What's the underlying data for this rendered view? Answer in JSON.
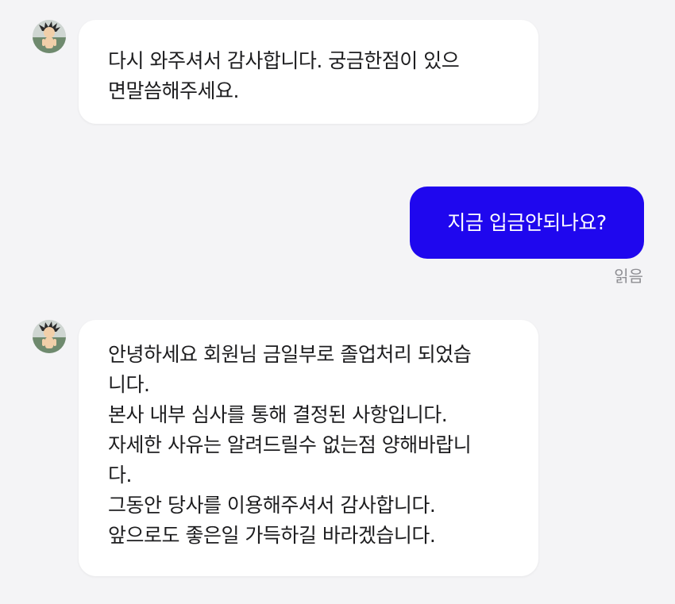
{
  "messages": [
    {
      "sender": "agent",
      "avatar_icon": "character-avatar-icon",
      "lines": [
        "다시 와주셔서 감사합니다. 궁금한점이 있으",
        "면말씀해주세요."
      ]
    },
    {
      "sender": "user",
      "text": "지금 입금안되나요?",
      "status": "읽음"
    },
    {
      "sender": "agent",
      "avatar_icon": "character-avatar-icon",
      "lines": [
        "안녕하세요 회원님 금일부로 졸업처리 되었습",
        "니다.",
        "본사 내부 심사를 통해 결정된 사항입니다.",
        "자세한 사유는 알려드릴수 없는점 양해바랍니",
        "다.",
        "그동안 당사를 이용해주셔서 감사합니다.",
        "앞으로도 좋은일 가득하길 바라겠습니다."
      ]
    }
  ],
  "colors": {
    "background": "#f4f4f6",
    "received_bubble": "#ffffff",
    "sent_bubble": "#1f07ee",
    "read_receipt": "#8e8e93"
  }
}
